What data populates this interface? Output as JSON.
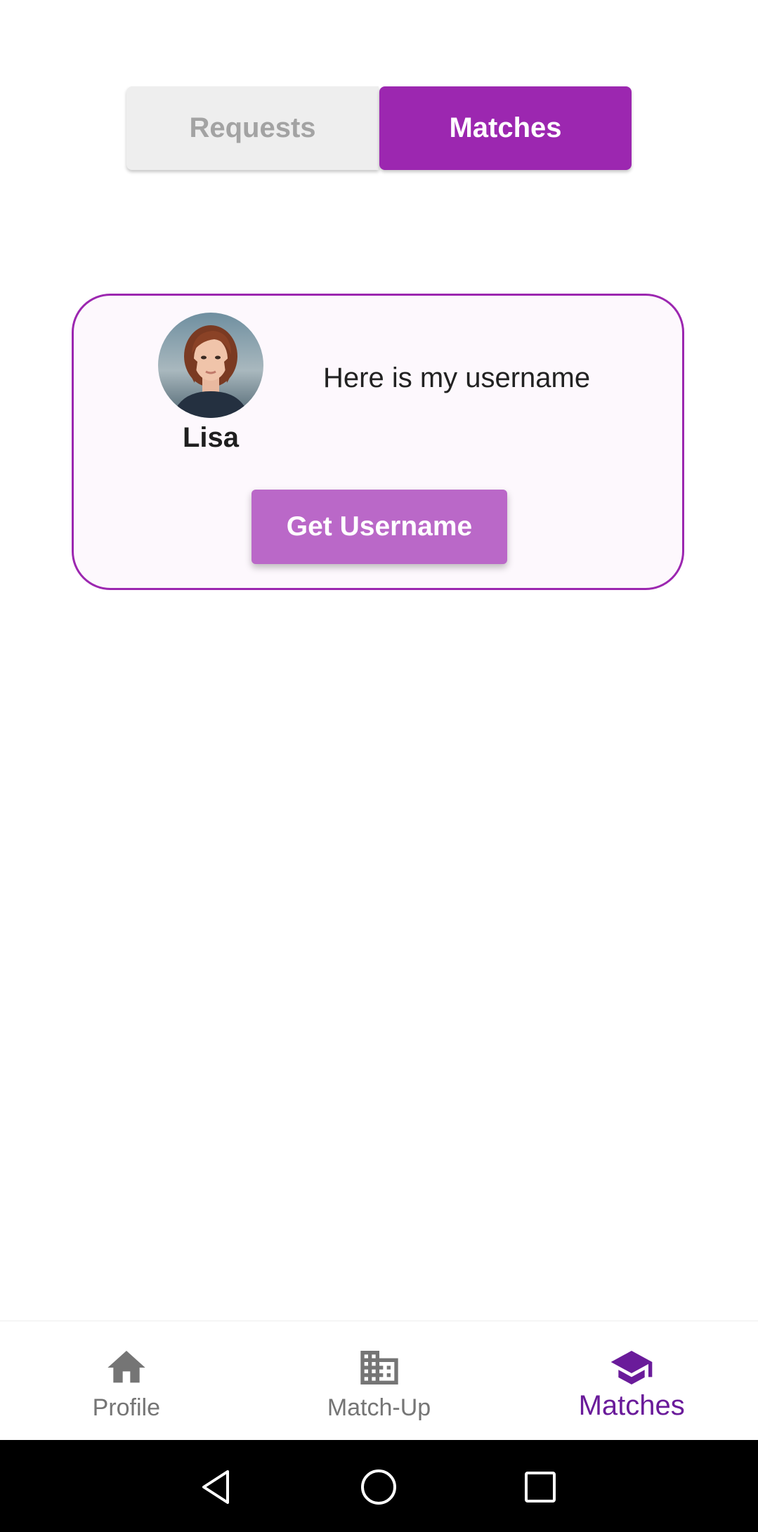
{
  "toggle": {
    "requests_label": "Requests",
    "matches_label": "Matches",
    "active": "Matches",
    "active_color": "#9c27b0"
  },
  "match": {
    "name": "Lisa",
    "message": "Here is my username",
    "button_label": "Get Username"
  },
  "bottom_nav": {
    "items": [
      {
        "label": "Profile",
        "icon": "home-icon"
      },
      {
        "label": "Match-Up",
        "icon": "building-icon"
      },
      {
        "label": "Matches",
        "icon": "graduation-cap-icon"
      }
    ],
    "active_index": 2,
    "active_color": "#6a1b9a"
  },
  "system_bar": {
    "buttons": [
      "back-icon",
      "home-circle-icon",
      "recents-icon"
    ]
  }
}
